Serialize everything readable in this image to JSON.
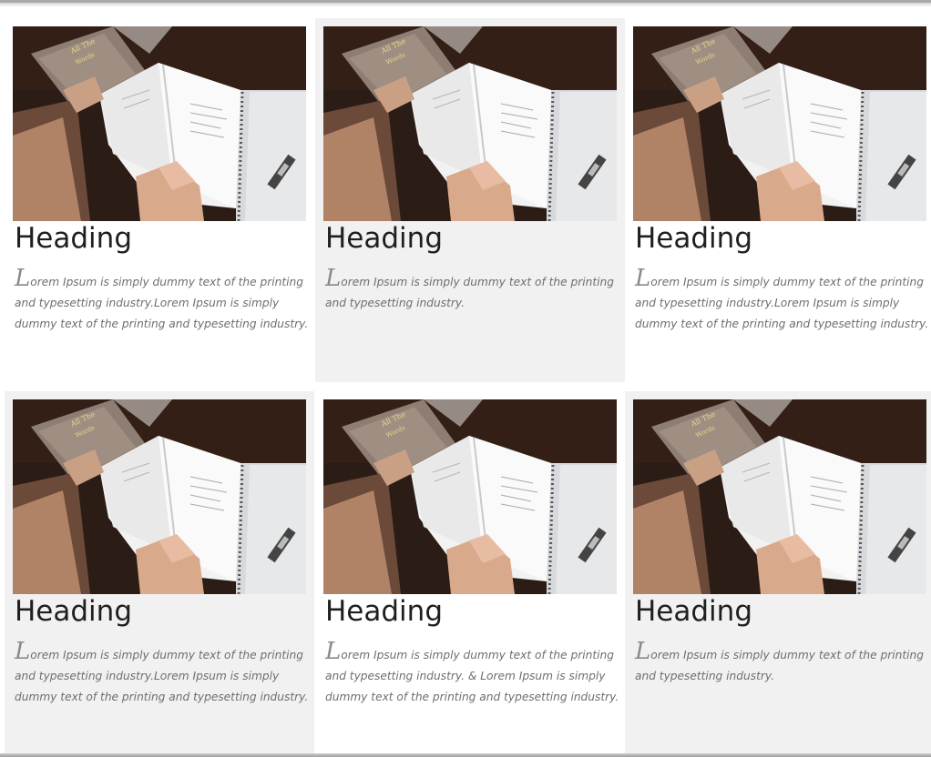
{
  "cards": [
    {
      "heading": "Heading",
      "dropcap": "L",
      "text": "orem Ipsum is simply dummy text of the printing and typesetting industry.Lorem Ipsum is simply dummy text of the printing and typesetting industry.",
      "image": "open-book-notebook-photo"
    },
    {
      "heading": "Heading",
      "dropcap": "L",
      "text": "orem Ipsum is simply dummy text of the printing and typesetting industry.",
      "image": "open-book-notebook-photo"
    },
    {
      "heading": "Heading",
      "dropcap": "L",
      "text": "orem Ipsum is simply dummy text of the printing and typesetting industry.Lorem Ipsum is simply dummy text of the printing and typesetting industry.",
      "image": "open-book-notebook-photo"
    },
    {
      "heading": "Heading",
      "dropcap": "L",
      "text": "orem Ipsum is simply dummy text of the printing and typesetting industry.Lorem Ipsum is simply dummy text of the printing and typesetting industry.",
      "image": "open-book-notebook-photo"
    },
    {
      "heading": "Heading",
      "dropcap": "L",
      "text": "orem Ipsum is simply dummy text of the printing and typesetting industry. & Lorem Ipsum is simply dummy text of the printing and typesetting industry.",
      "image": "open-book-notebook-photo"
    },
    {
      "heading": "Heading",
      "dropcap": "L",
      "text": "orem Ipsum is simply dummy text of the printing and typesetting industry.",
      "image": "open-book-notebook-photo"
    }
  ],
  "colors": {
    "shaded_card": "#f1f1f1",
    "heading": "#1f1f1f",
    "body_text": "#6e6e6e"
  }
}
